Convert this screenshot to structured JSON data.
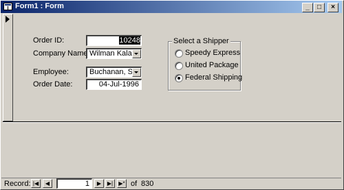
{
  "window": {
    "title": "Form1 : Form",
    "controls": {
      "minimize": "_",
      "maximize": "□",
      "close": "×"
    }
  },
  "form": {
    "order_id": {
      "label": "Order ID:",
      "value": "10248"
    },
    "company": {
      "label": "Company Name",
      "value": "Wilman Kala"
    },
    "employee": {
      "label": "Employee:",
      "value": "Buchanan, Stev"
    },
    "order_date": {
      "label": "Order Date:",
      "value": "04-Jul-1996"
    },
    "shipper": {
      "title": "Select a Shipper",
      "options": [
        {
          "label": "Speedy Express",
          "checked": false
        },
        {
          "label": "United Package",
          "checked": false
        },
        {
          "label": "Federal Shipping",
          "checked": true
        }
      ]
    }
  },
  "navigation": {
    "record_label": "Record:",
    "current": "1",
    "of_label": "of",
    "total": "830",
    "icons": [
      "first-record-icon",
      "prev-record-icon",
      "next-record-icon",
      "last-record-icon",
      "new-record-icon"
    ]
  },
  "colors": {
    "titlebar_start": "#0a246a",
    "titlebar_end": "#a6caf0",
    "face": "#d4d0c8",
    "selection": "#000000"
  }
}
